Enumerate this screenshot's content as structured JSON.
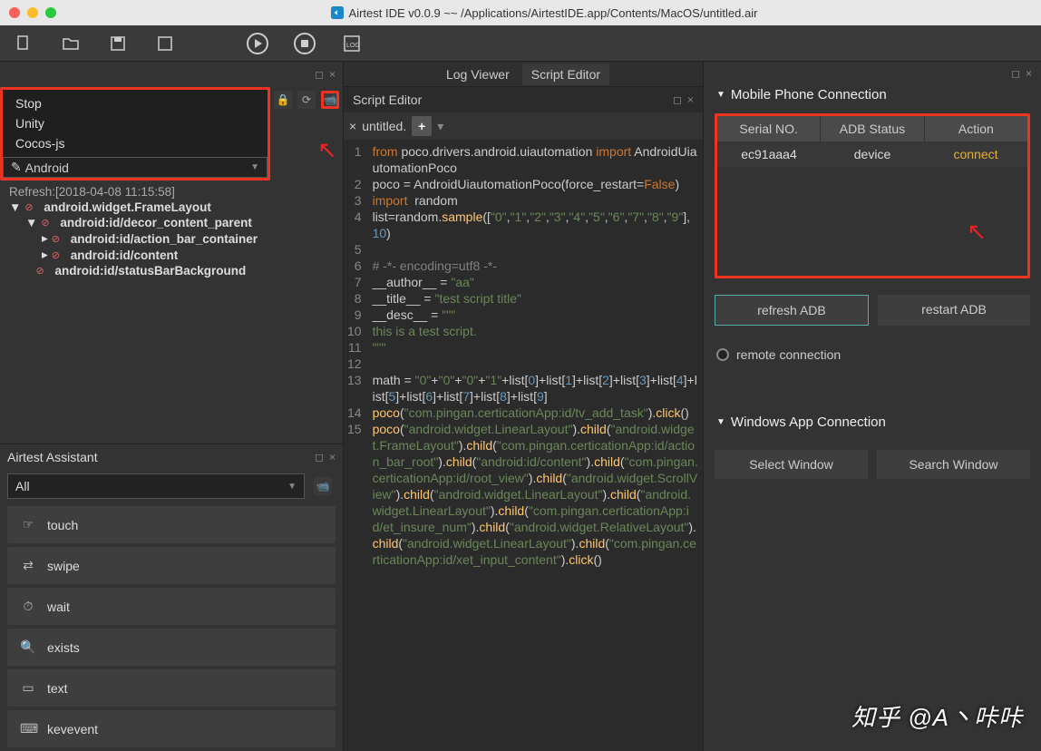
{
  "titlebar": {
    "title": "Airtest IDE v0.0.9 ~~ /Applications/AirtestIDE.app/Contents/MacOS/untitled.air"
  },
  "dropdown": {
    "options": [
      "Stop",
      "Unity",
      "Cocos-js",
      "Android"
    ],
    "selected": "Android"
  },
  "tree": {
    "refresh_label": "Refresh:[2018-04-08 11:15:58]",
    "root": "android.widget.FrameLayout",
    "n1": "android:id/decor_content_parent",
    "n2": "android:id/action_bar_container",
    "n3": "android:id/content",
    "n4": "android:id/statusBarBackground"
  },
  "assistant": {
    "title": "Airtest Assistant",
    "filter": "All",
    "items": [
      "touch",
      "swipe",
      "wait",
      "exists",
      "text",
      "kevevent"
    ]
  },
  "tabs": {
    "log_viewer": "Log Viewer",
    "script_editor": "Script Editor"
  },
  "editor": {
    "title": "Script Editor",
    "file": "untitled.",
    "close_glyph": "×"
  },
  "code": {
    "lines": [
      {
        "n": "1",
        "html": "<span class='kw'>from</span> poco.drivers.android.uiautomation <span class='kw'>import</span> AndroidUiautomationPoco"
      },
      {
        "n": "2",
        "html": "poco = AndroidUiautomationPoco(force_restart=<span class='bool'>False</span>)"
      },
      {
        "n": "3",
        "html": "<span class='kw'>import</span>  random"
      },
      {
        "n": "4",
        "html": "list=random.<span class='fn'>sample</span>([<span class='str'>\"0\"</span>,<span class='str'>\"1\"</span>,<span class='str'>\"2\"</span>,<span class='str'>\"3\"</span>,<span class='str'>\"4\"</span>,<span class='str'>\"5\"</span>,<span class='str'>\"6\"</span>,<span class='str'>\"7\"</span>,<span class='str'>\"8\"</span>,<span class='str'>\"9\"</span>], <span class='num'>10</span>)"
      },
      {
        "n": "5",
        "html": ""
      },
      {
        "n": "6",
        "html": "<span class='cm'># -*- encoding=utf8 -*-</span>"
      },
      {
        "n": "7",
        "html": "__author__ = <span class='str'>\"aa\"</span>"
      },
      {
        "n": "8",
        "html": "__title__ = <span class='str'>\"test script title\"</span>"
      },
      {
        "n": "9",
        "html": "__desc__ = <span class='str'>\"\"\"</span>"
      },
      {
        "n": "10",
        "html": "<span class='str'>this is a test script.</span>"
      },
      {
        "n": "11",
        "html": "<span class='str'>\"\"\"</span>"
      },
      {
        "n": "12",
        "html": ""
      },
      {
        "n": "13",
        "html": "math = <span class='str'>\"0\"</span>+<span class='str'>\"0\"</span>+<span class='str'>\"0\"</span>+<span class='str'>\"1\"</span>+list[<span class='num'>0</span>]+list[<span class='num'>1</span>]+list[<span class='num'>2</span>]+list[<span class='num'>3</span>]+list[<span class='num'>4</span>]+list[<span class='num'>5</span>]+list[<span class='num'>6</span>]+list[<span class='num'>7</span>]+list[<span class='num'>8</span>]+list[<span class='num'>9</span>]"
      },
      {
        "n": "14",
        "html": "<span class='fn'>poco</span>(<span class='str'>\"com.pingan.certicationApp:id/tv_add_task\"</span>).<span class='fn'>click</span>()"
      },
      {
        "n": "15",
        "html": "<span class='fn'>poco</span>(<span class='str'>\"android.widget.LinearLayout\"</span>).<span class='fn'>child</span>(<span class='str'>\"android.widget.FrameLayout\"</span>).<span class='fn'>child</span>(<span class='str'>\"com.pingan.certicationApp:id/action_bar_root\"</span>).<span class='fn'>child</span>(<span class='str'>\"android:id/content\"</span>).<span class='fn'>child</span>(<span class='str'>\"com.pingan.certicationApp:id/root_view\"</span>).<span class='fn'>child</span>(<span class='str'>\"android.widget.ScrollView\"</span>).<span class='fn'>child</span>(<span class='str'>\"android.widget.LinearLayout\"</span>).<span class='fn'>child</span>(<span class='str'>\"android.widget.LinearLayout\"</span>).<span class='fn'>child</span>(<span class='str'>\"com.pingan.certicationApp:id/et_insure_num\"</span>).<span class='fn'>child</span>(<span class='str'>\"android.widget.RelativeLayout\"</span>).<span class='fn'>child</span>(<span class='str'>\"android.widget.LinearLayout\"</span>).<span class='fn'>child</span>(<span class='str'>\"com.pingan.certicationApp:id/xet_input_content\"</span>).<span class='fn'>click</span>()"
      }
    ]
  },
  "right": {
    "mobile_title": "Mobile Phone Connection",
    "cols": {
      "serial": "Serial NO.",
      "adb": "ADB Status",
      "action": "Action"
    },
    "device": {
      "serial": "ec91aaa4",
      "adb": "device",
      "action": "connect"
    },
    "refresh": "refresh ADB",
    "restart": "restart ADB",
    "remote": "remote connection",
    "win_title": "Windows App Connection",
    "select": "Select Window",
    "search": "Search Window"
  },
  "watermark": "知乎 @A丶咔咔"
}
